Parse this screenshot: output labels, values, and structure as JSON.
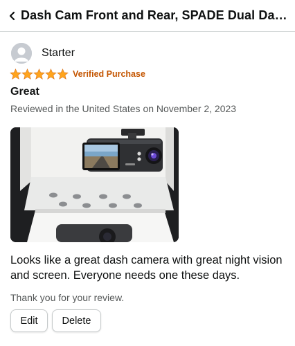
{
  "header": {
    "back_icon": "chevron-left-icon",
    "title": "Dash Cam Front and Rear, SPADE Dual Dash C..."
  },
  "reviewer": {
    "avatar_icon": "user-avatar-icon",
    "name": "Starter"
  },
  "rating": {
    "stars": 5,
    "star_color": "#ffa41c",
    "verified_label": "Verified Purchase",
    "verified_color": "#c45500"
  },
  "review": {
    "title": "Great",
    "date": "Reviewed in the United States on November 2, 2023",
    "image_description_icon": "review-photo",
    "body": "Looks like a great dash camera with great night vision and screen. Everyone needs one these days.",
    "thanks": "Thank you for your review."
  },
  "actions": {
    "edit_label": "Edit",
    "delete_label": "Delete"
  }
}
